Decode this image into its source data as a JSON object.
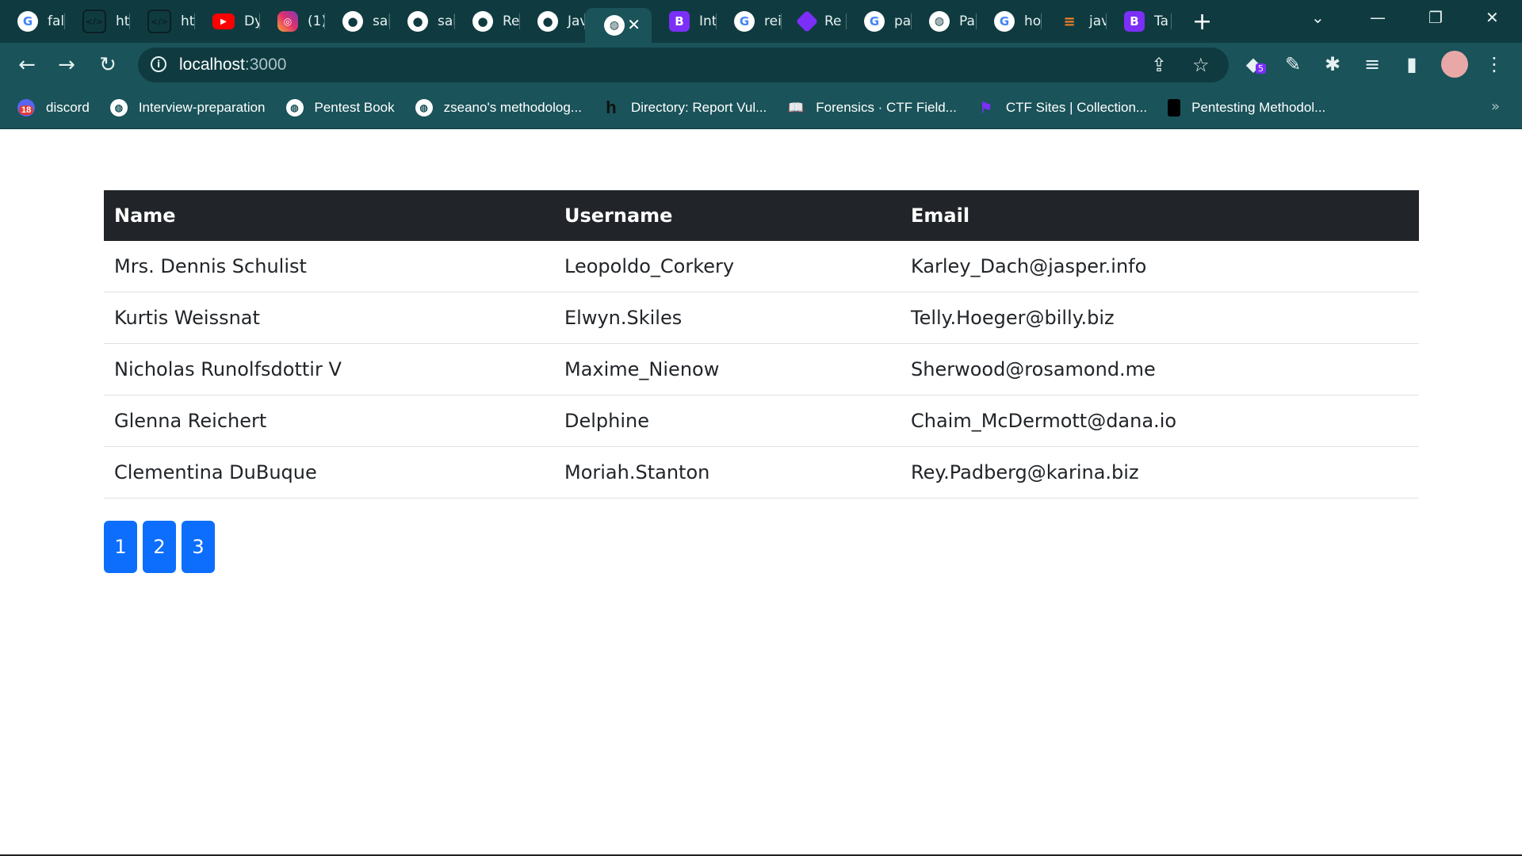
{
  "browser": {
    "tabs": [
      {
        "icon": "google-icon",
        "label": "fal"
      },
      {
        "icon": "html-icon",
        "label": "htl"
      },
      {
        "icon": "html-icon",
        "label": "htl"
      },
      {
        "icon": "youtube-icon",
        "label": "Dy"
      },
      {
        "icon": "instagram-icon",
        "label": "(1)"
      },
      {
        "icon": "github-icon",
        "label": "sai"
      },
      {
        "icon": "github-icon",
        "label": "sai"
      },
      {
        "icon": "github-icon",
        "label": "Re"
      },
      {
        "icon": "github-icon",
        "label": "Jav"
      },
      {
        "icon": "globe-icon",
        "label": "",
        "active": true
      },
      {
        "icon": "bootstrap-icon",
        "label": "Int"
      },
      {
        "icon": "google-icon",
        "label": "rei"
      },
      {
        "icon": "react-icon",
        "label": "Re"
      },
      {
        "icon": "google-icon",
        "label": "pa"
      },
      {
        "icon": "globe-icon",
        "label": "Pa"
      },
      {
        "icon": "google-icon",
        "label": "ho"
      },
      {
        "icon": "stackoverflow-icon",
        "label": "jav"
      },
      {
        "icon": "bootstrap-icon",
        "label": "Ta"
      }
    ],
    "url_host": "localhost",
    "url_port": ":3000",
    "extensions_badge": "5",
    "bookmarks": [
      {
        "label": "discord",
        "badge": "18"
      },
      {
        "label": "Interview-preparation"
      },
      {
        "label": "Pentest Book"
      },
      {
        "label": "zseano's methodolog..."
      },
      {
        "label": "Directory: Report Vul..."
      },
      {
        "label": "Forensics · CTF Field..."
      },
      {
        "label": "CTF Sites | Collection..."
      },
      {
        "label": "Pentesting Methodol..."
      }
    ]
  },
  "table": {
    "headers": [
      "Name",
      "Username",
      "Email"
    ],
    "rows": [
      [
        "Mrs. Dennis Schulist",
        "Leopoldo_Corkery",
        "Karley_Dach@jasper.info"
      ],
      [
        "Kurtis Weissnat",
        "Elwyn.Skiles",
        "Telly.Hoeger@billy.biz"
      ],
      [
        "Nicholas Runolfsdottir V",
        "Maxime_Nienow",
        "Sherwood@rosamond.me"
      ],
      [
        "Glenna Reichert",
        "Delphine",
        "Chaim_McDermott@dana.io"
      ],
      [
        "Clementina DuBuque",
        "Moriah.Stanton",
        "Rey.Padberg@karina.biz"
      ]
    ]
  },
  "pagination": [
    "1",
    "2",
    "3"
  ],
  "colors": {
    "header_bg": "#212529",
    "page_button": "#0d6efd",
    "chrome_dark": "#0f3b40",
    "chrome_light": "#1a535a"
  }
}
